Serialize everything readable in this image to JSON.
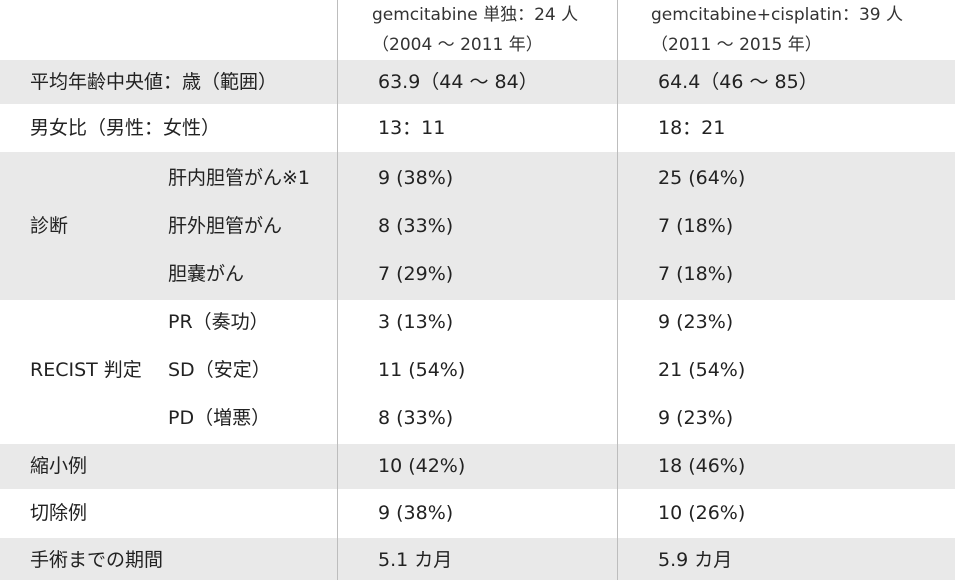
{
  "header": {
    "gem_line1": "gemcitabine 単独：24 人",
    "gem_line2": "（2004 〜 2011 年）",
    "gemcis_line1": "gemcitabine+cisplatin：39 人",
    "gemcis_line2": "（2011 〜 2015 年）"
  },
  "rows": {
    "age": {
      "label": "平均年齢中央値：歳（範囲）",
      "gem": "63.9（44 〜 84）",
      "gemcis": "64.4（46 〜 85）"
    },
    "sex": {
      "label": "男女比（男性：女性）",
      "gem": "13：11",
      "gemcis": "18：21"
    },
    "diagnosis": {
      "label": "診断",
      "items": [
        {
          "sub": "肝内胆管がん※1",
          "gem": "9 (38%)",
          "gemcis": "25 (64%)"
        },
        {
          "sub": "肝外胆管がん",
          "gem": "8 (33%)",
          "gemcis": "7 (18%)"
        },
        {
          "sub": "胆嚢がん",
          "gem": "7 (29%)",
          "gemcis": "7 (18%)"
        }
      ]
    },
    "recist": {
      "label": "RECIST 判定",
      "items": [
        {
          "sub": "PR（奏功）",
          "gem": "3 (13%)",
          "gemcis": "9 (23%)"
        },
        {
          "sub": "SD（安定）",
          "gem": "11 (54%)",
          "gemcis": "21 (54%)"
        },
        {
          "sub": "PD（増悪）",
          "gem": "8 (33%)",
          "gemcis": "9 (23%)"
        }
      ]
    },
    "shrink": {
      "label": "縮小例",
      "gem": "10 (42%)",
      "gemcis": "18 (46%)"
    },
    "resection": {
      "label": "切除例",
      "gem": "9 (38%)",
      "gemcis": "10 (26%)"
    },
    "period": {
      "label": "手術までの期間",
      "gem": "5.1 カ月",
      "gemcis": "5.9 カ月"
    }
  }
}
